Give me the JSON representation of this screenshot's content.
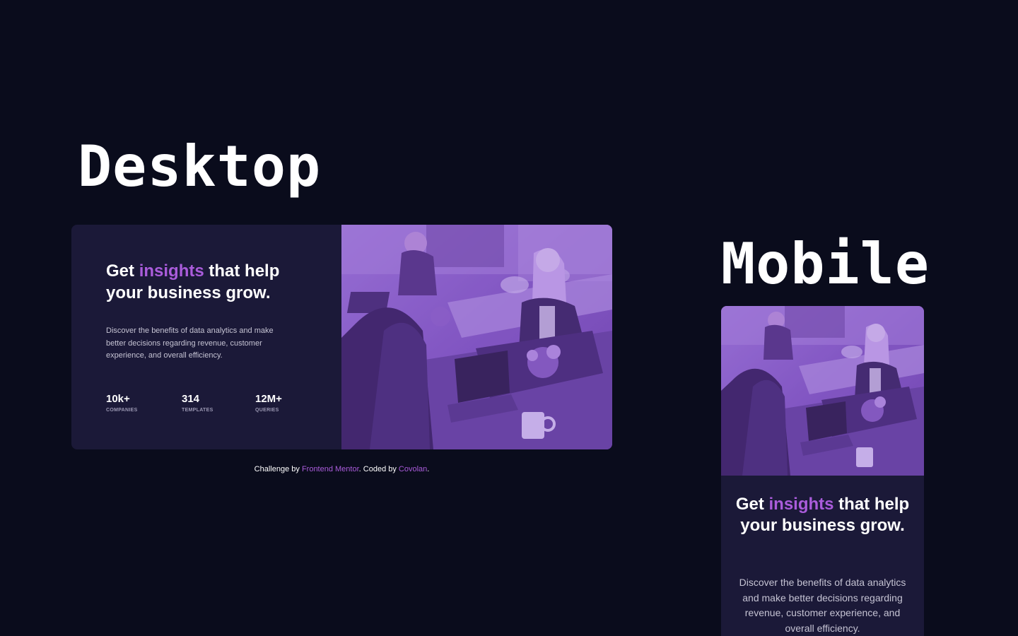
{
  "labels": {
    "desktop": "Desktop",
    "mobile": "Mobile"
  },
  "card": {
    "heading_before": "Get ",
    "heading_accent": "insights",
    "heading_after": " that help your business grow.",
    "description": "Discover the benefits of data analytics and make better decisions regarding revenue, customer experience, and overall efficiency.",
    "stats": [
      {
        "value": "10k+",
        "label": "COMPANIES"
      },
      {
        "value": "314",
        "label": "TEMPLATES"
      },
      {
        "value": "12M+",
        "label": "QUERIES"
      }
    ],
    "image_icon": "office-team-photo"
  },
  "footer": {
    "challenge_by": "Challenge by ",
    "frontend_mentor": "Frontend Mentor",
    "coded_by": ". Coded by ",
    "author": "Covolan",
    "period": "."
  },
  "colors": {
    "background": "#0a0c1c",
    "card": "#1b1938",
    "accent": "#aa5cdb",
    "image_tint": "#8d5fcc"
  }
}
